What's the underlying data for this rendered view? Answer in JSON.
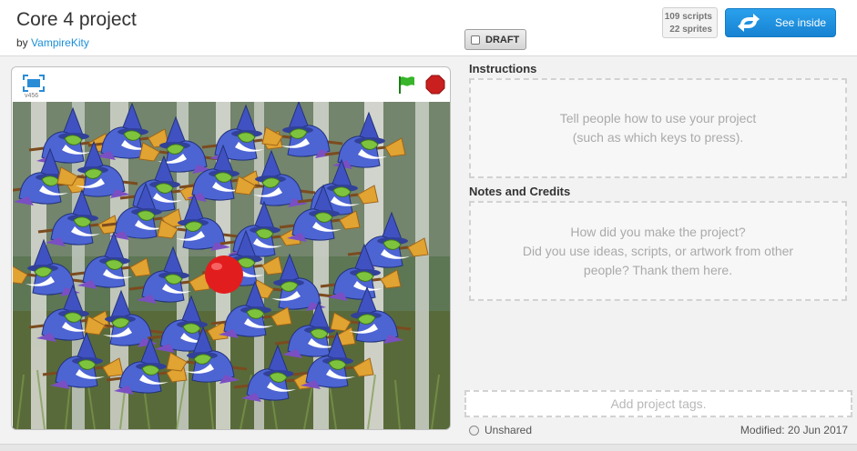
{
  "project": {
    "title": "Core 4 project",
    "by_prefix": "by",
    "author": "VampireKity"
  },
  "header": {
    "draft_label": "DRAFT",
    "scripts_count": "109 scripts",
    "sprites_count": "22 sprites",
    "see_inside_label": "See inside"
  },
  "player": {
    "version": "v456",
    "icons": [
      "fullscreen-icon",
      "green-flag-icon",
      "stop-icon"
    ]
  },
  "instructions": {
    "title": "Instructions",
    "placeholder_line1": "Tell people how to use your project",
    "placeholder_line2": "(such as which keys to press)."
  },
  "notes": {
    "title": "Notes and Credits",
    "placeholder_line1": "How did you make the project?",
    "placeholder_line2": "Did you use ideas, scripts, or artwork from other",
    "placeholder_line3": "people? Thank them here."
  },
  "tags": {
    "placeholder": "Add project tags."
  },
  "status": {
    "sharing": "Unshared",
    "modified": "Modified: 20 Jun 2017"
  },
  "colors": {
    "accent": "#1b8fd8",
    "see_inside": "#1f8fde",
    "flag": "#38b52a",
    "stop": "#c91f1f"
  }
}
